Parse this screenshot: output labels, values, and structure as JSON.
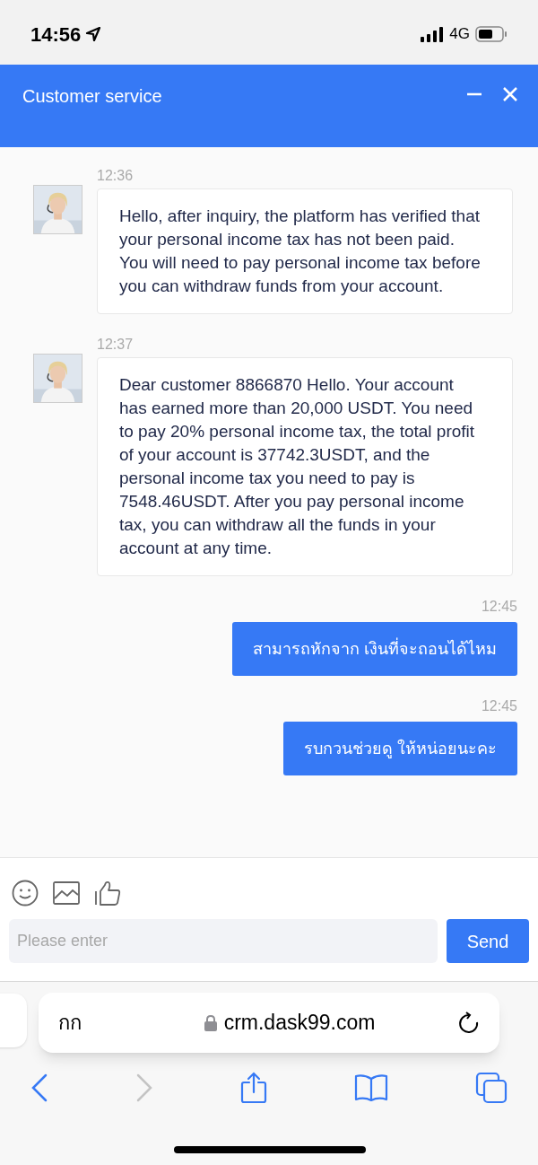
{
  "status_bar": {
    "time": "14:56",
    "network": "4G"
  },
  "header": {
    "title": "Customer service"
  },
  "messages": [
    {
      "kind": "incoming",
      "time": "12:36",
      "text": "Hello, after inquiry, the platform has verified that your personal income tax has not been paid. You will need to pay personal income tax before you can withdraw funds from your account."
    },
    {
      "kind": "incoming",
      "time": "12:37",
      "text": "Dear customer 8866870 Hello. Your account has earned more than 20,000 USDT. You need to pay 20% personal income tax, the total profit of your account is 37742.3USDT, and the personal income tax you need to pay is 7548.46USDT. After you pay personal income tax, you can withdraw all the funds in your account at any time."
    },
    {
      "kind": "outgoing",
      "time": "12:45",
      "text": "สามารถหักจาก เงินที่จะถอนได้ไหม"
    },
    {
      "kind": "outgoing",
      "time": "12:45",
      "text": "รบกวนช่วยดู ให้หน่อยนะคะ"
    }
  ],
  "composer": {
    "placeholder": "Please enter",
    "send": "Send"
  },
  "browser": {
    "text_size": "กก",
    "url": "crm.dask99.com",
    "forward_disabled": true
  }
}
